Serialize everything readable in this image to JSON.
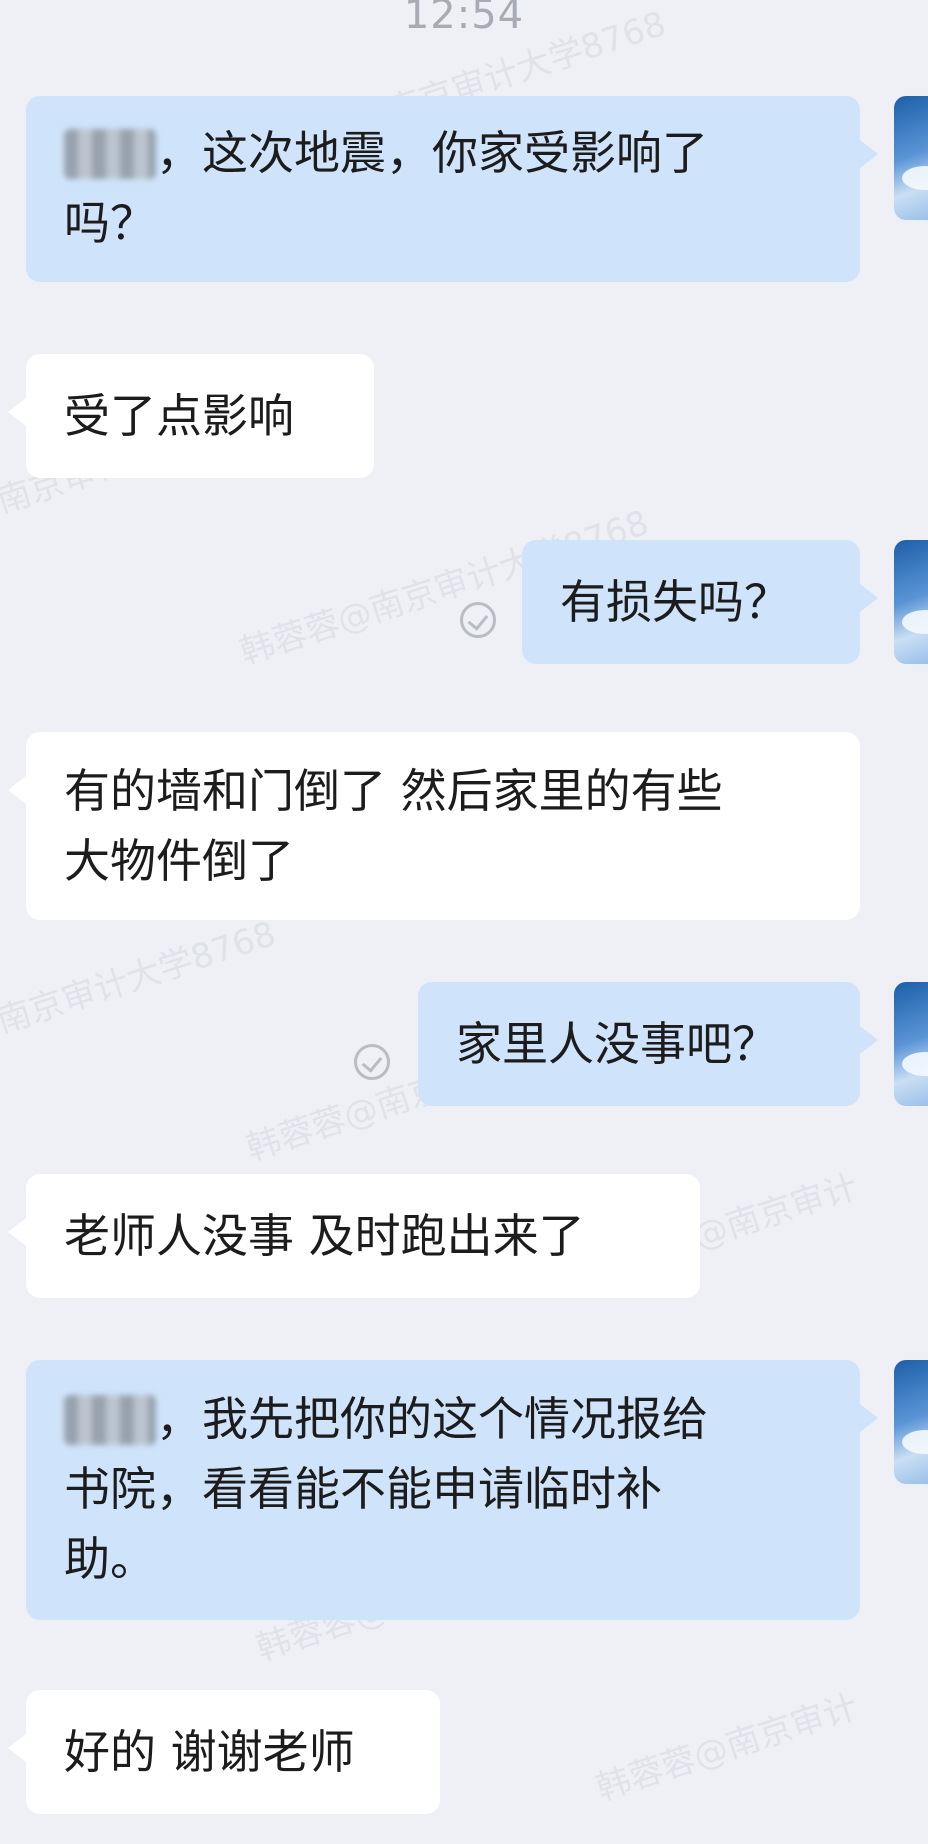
{
  "status_bar": {
    "time": "12:54"
  },
  "messages": [
    {
      "side": "out",
      "prefix_redacted": true,
      "lines": [
        "，这次地震，你家受影响了",
        "吗？"
      ]
    },
    {
      "side": "in",
      "lines": [
        "受了点影响"
      ]
    },
    {
      "side": "out",
      "lines": [
        "有损失吗？"
      ],
      "read_receipt": true
    },
    {
      "side": "in",
      "lines": [
        "有的墙和门倒了 然后家里的有些",
        "大物件倒了"
      ]
    },
    {
      "side": "out",
      "lines": [
        "家里人没事吧？"
      ],
      "read_receipt": true
    },
    {
      "side": "in",
      "lines": [
        "老师人没事 及时跑出来了"
      ]
    },
    {
      "side": "out",
      "prefix_redacted": true,
      "lines": [
        "，我先把你的这个情况报给",
        "书院，看看能不能申请临时补",
        "助。"
      ]
    },
    {
      "side": "in",
      "lines": [
        "好的 谢谢老师"
      ]
    }
  ],
  "watermark": {
    "texts": [
      "韩蓉蓉@南京审计大学8768",
      "南京审计大学8768",
      "韩蓉蓉@南京审计"
    ]
  },
  "colors": {
    "background": "#eef0f5",
    "incoming_bubble": "#ffffff",
    "outgoing_bubble": "#cfe3fa",
    "text": "#1c1c1c",
    "time": "#a8abb3"
  },
  "icons": {
    "read_receipt": "check-circle-icon",
    "avatar": "sky-avatar"
  }
}
